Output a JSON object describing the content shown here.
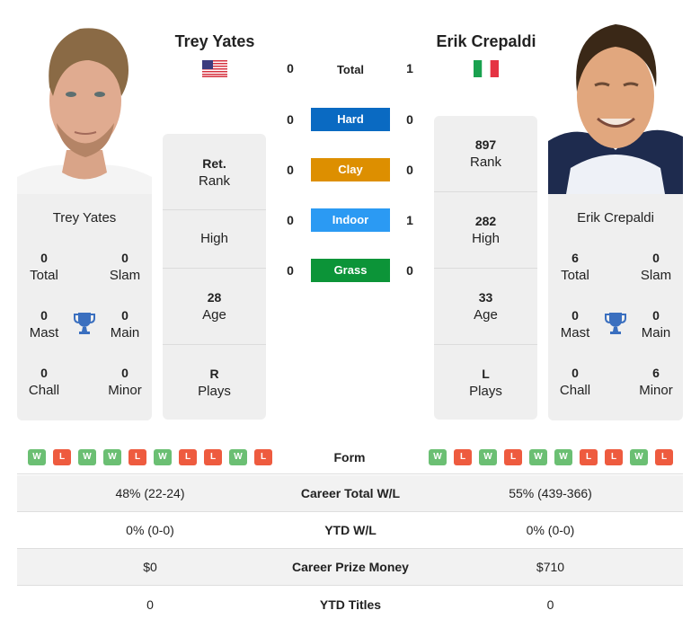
{
  "players": {
    "left": {
      "name": "Trey Yates",
      "country_flag": "usa-flag",
      "rank": "Ret.",
      "rank_label": "Rank",
      "high": "",
      "high_label": "High",
      "age": "28",
      "age_label": "Age",
      "plays": "R",
      "plays_label": "Plays",
      "titles": {
        "total": "0",
        "total_label": "Total",
        "slam": "0",
        "slam_label": "Slam",
        "mast": "0",
        "mast_label": "Mast",
        "main": "0",
        "main_label": "Main",
        "chall": "0",
        "chall_label": "Chall",
        "minor": "0",
        "minor_label": "Minor"
      },
      "form": [
        "W",
        "L",
        "W",
        "W",
        "L",
        "W",
        "L",
        "L",
        "W",
        "L"
      ]
    },
    "right": {
      "name": "Erik Crepaldi",
      "country_flag": "italy-flag",
      "rank": "897",
      "rank_label": "Rank",
      "high": "282",
      "high_label": "High",
      "age": "33",
      "age_label": "Age",
      "plays": "L",
      "plays_label": "Plays",
      "titles": {
        "total": "6",
        "total_label": "Total",
        "slam": "0",
        "slam_label": "Slam",
        "mast": "0",
        "mast_label": "Mast",
        "main": "0",
        "main_label": "Main",
        "chall": "0",
        "chall_label": "Chall",
        "minor": "6",
        "minor_label": "Minor"
      },
      "form": [
        "W",
        "L",
        "W",
        "L",
        "W",
        "W",
        "L",
        "L",
        "W",
        "L"
      ]
    }
  },
  "h2h": [
    {
      "label": "Total",
      "left": "0",
      "right": "1",
      "color": ""
    },
    {
      "label": "Hard",
      "left": "0",
      "right": "0",
      "color": "#0a6ac2"
    },
    {
      "label": "Clay",
      "left": "0",
      "right": "0",
      "color": "#dd8f00"
    },
    {
      "label": "Indoor",
      "left": "0",
      "right": "1",
      "color": "#2b9af3"
    },
    {
      "label": "Grass",
      "left": "0",
      "right": "0",
      "color": "#0c9438"
    }
  ],
  "form_label": "Form",
  "form_colors": {
    "W": "#6bbf73",
    "L": "#ee5b3f"
  },
  "comparison": [
    {
      "label": "Career Total W/L",
      "left": "48% (22-24)",
      "right": "55% (439-366)"
    },
    {
      "label": "YTD W/L",
      "left": "0% (0-0)",
      "right": "0% (0-0)"
    },
    {
      "label": "Career Prize Money",
      "left": "$0",
      "right": "$710"
    },
    {
      "label": "YTD Titles",
      "left": "0",
      "right": "0"
    }
  ],
  "icons": {
    "trophy": "trophy-icon"
  }
}
